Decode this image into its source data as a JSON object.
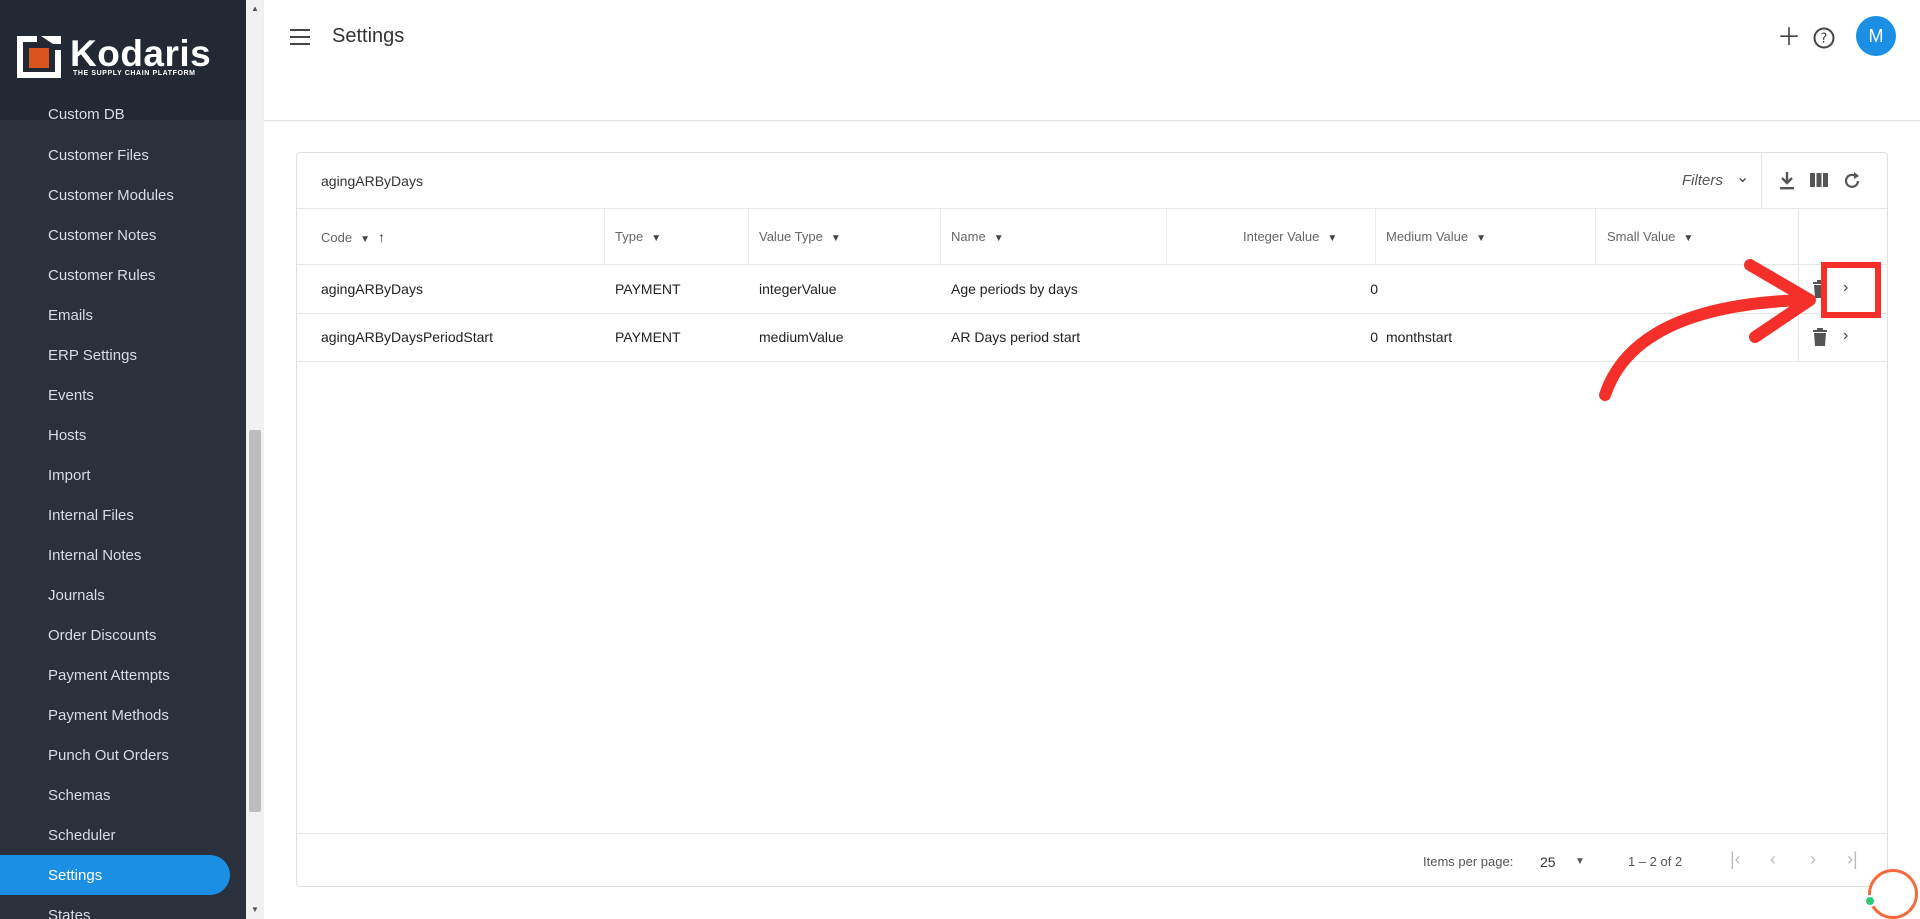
{
  "app": {
    "brand": "Kodaris",
    "tagline": "THE SUPPLY CHAIN PLATFORM",
    "brand_accent": "#d9531e",
    "accent": "#1b8fe4"
  },
  "sidebar": {
    "partial_item": "Custom DB",
    "items": [
      {
        "label": "Customer Files"
      },
      {
        "label": "Customer Modules"
      },
      {
        "label": "Customer Notes"
      },
      {
        "label": "Customer Rules"
      },
      {
        "label": "Emails"
      },
      {
        "label": "ERP Settings"
      },
      {
        "label": "Events"
      },
      {
        "label": "Hosts"
      },
      {
        "label": "Import"
      },
      {
        "label": "Internal Files"
      },
      {
        "label": "Internal Notes"
      },
      {
        "label": "Journals"
      },
      {
        "label": "Order Discounts"
      },
      {
        "label": "Payment Attempts"
      },
      {
        "label": "Payment Methods"
      },
      {
        "label": "Punch Out Orders"
      },
      {
        "label": "Schemas"
      },
      {
        "label": "Scheduler"
      },
      {
        "label": "Settings"
      },
      {
        "label": "States"
      }
    ],
    "active": "Settings"
  },
  "header": {
    "title": "Settings",
    "avatar_initial": "M",
    "icons": [
      "menu-icon",
      "add-icon",
      "help-icon",
      "avatar"
    ]
  },
  "toolbar": {
    "search_value": "agingARByDays",
    "filters_label": "Filters",
    "icons": [
      "download-icon",
      "columns-icon",
      "refresh-icon"
    ]
  },
  "table": {
    "columns": [
      "Code",
      "Type",
      "Value Type",
      "Name",
      "Integer Value",
      "Medium Value",
      "Small Value"
    ],
    "rows": [
      {
        "code": "agingARByDays",
        "type": "PAYMENT",
        "value_type": "integerValue",
        "name": "Age periods by days",
        "integer_value": "0",
        "medium_value": "",
        "small_value": ""
      },
      {
        "code": "agingARByDaysPeriodStart",
        "type": "PAYMENT",
        "value_type": "mediumValue",
        "name": "AR Days period start",
        "integer_value": "0",
        "medium_value": "monthstart",
        "small_value": ""
      }
    ]
  },
  "paginator": {
    "items_per_page_label": "Items per page:",
    "items_per_page": "25",
    "range": "1 – 2 of 2"
  },
  "annotation": {
    "color": "#f5302a"
  }
}
